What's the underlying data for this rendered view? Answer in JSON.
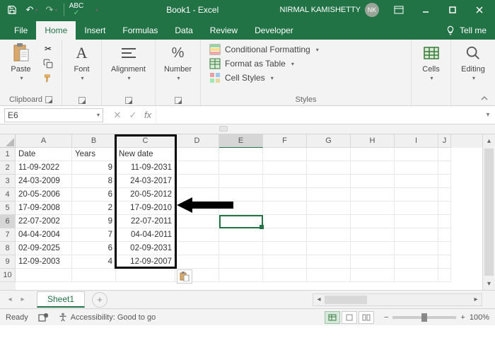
{
  "titlebar": {
    "title": "Book1 - Excel",
    "user_name": "NIRMAL KAMISHETTY",
    "user_initials": "NK"
  },
  "tabs": {
    "file": "File",
    "home": "Home",
    "insert": "Insert",
    "formulas": "Formulas",
    "data": "Data",
    "review": "Review",
    "developer": "Developer",
    "tellme": "Tell me"
  },
  "ribbon": {
    "clipboard": {
      "label": "Clipboard",
      "paste": "Paste"
    },
    "font": {
      "label": "Font",
      "button": "Font"
    },
    "alignment": {
      "label": "Alignment",
      "button": "Alignment"
    },
    "number": {
      "label": "Number",
      "button": "Number"
    },
    "styles": {
      "label": "Styles",
      "cond_format": "Conditional Formatting",
      "format_table": "Format as Table",
      "cell_styles": "Cell Styles"
    },
    "cells": {
      "label": "Cells",
      "button": "Cells"
    },
    "editing": {
      "label": "Editing",
      "button": "Editing"
    }
  },
  "namebox": {
    "value": "E6"
  },
  "columns": [
    "A",
    "B",
    "C",
    "D",
    "E",
    "F",
    "G",
    "H",
    "I",
    "J"
  ],
  "row_numbers": [
    "1",
    "2",
    "3",
    "4",
    "5",
    "6",
    "7",
    "8",
    "9",
    "10"
  ],
  "headers": {
    "a": "Date",
    "b": "Years",
    "c": "New date"
  },
  "data_rows": [
    {
      "a": "11-09-2022",
      "b": "9",
      "c": "11-09-2031"
    },
    {
      "a": "24-03-2009",
      "b": "8",
      "c": "24-03-2017"
    },
    {
      "a": "20-05-2006",
      "b": "6",
      "c": "20-05-2012"
    },
    {
      "a": "17-09-2008",
      "b": "2",
      "c": "17-09-2010"
    },
    {
      "a": "22-07-2002",
      "b": "9",
      "c": "22-07-2011"
    },
    {
      "a": "04-04-2004",
      "b": "7",
      "c": "04-04-2011"
    },
    {
      "a": "02-09-2025",
      "b": "6",
      "c": "02-09-2031"
    },
    {
      "a": "12-09-2003",
      "b": "4",
      "c": "12-09-2007"
    }
  ],
  "sheet": {
    "name": "Sheet1"
  },
  "status": {
    "ready": "Ready",
    "accessibility": "Accessibility: Good to go",
    "zoom": "100%"
  }
}
